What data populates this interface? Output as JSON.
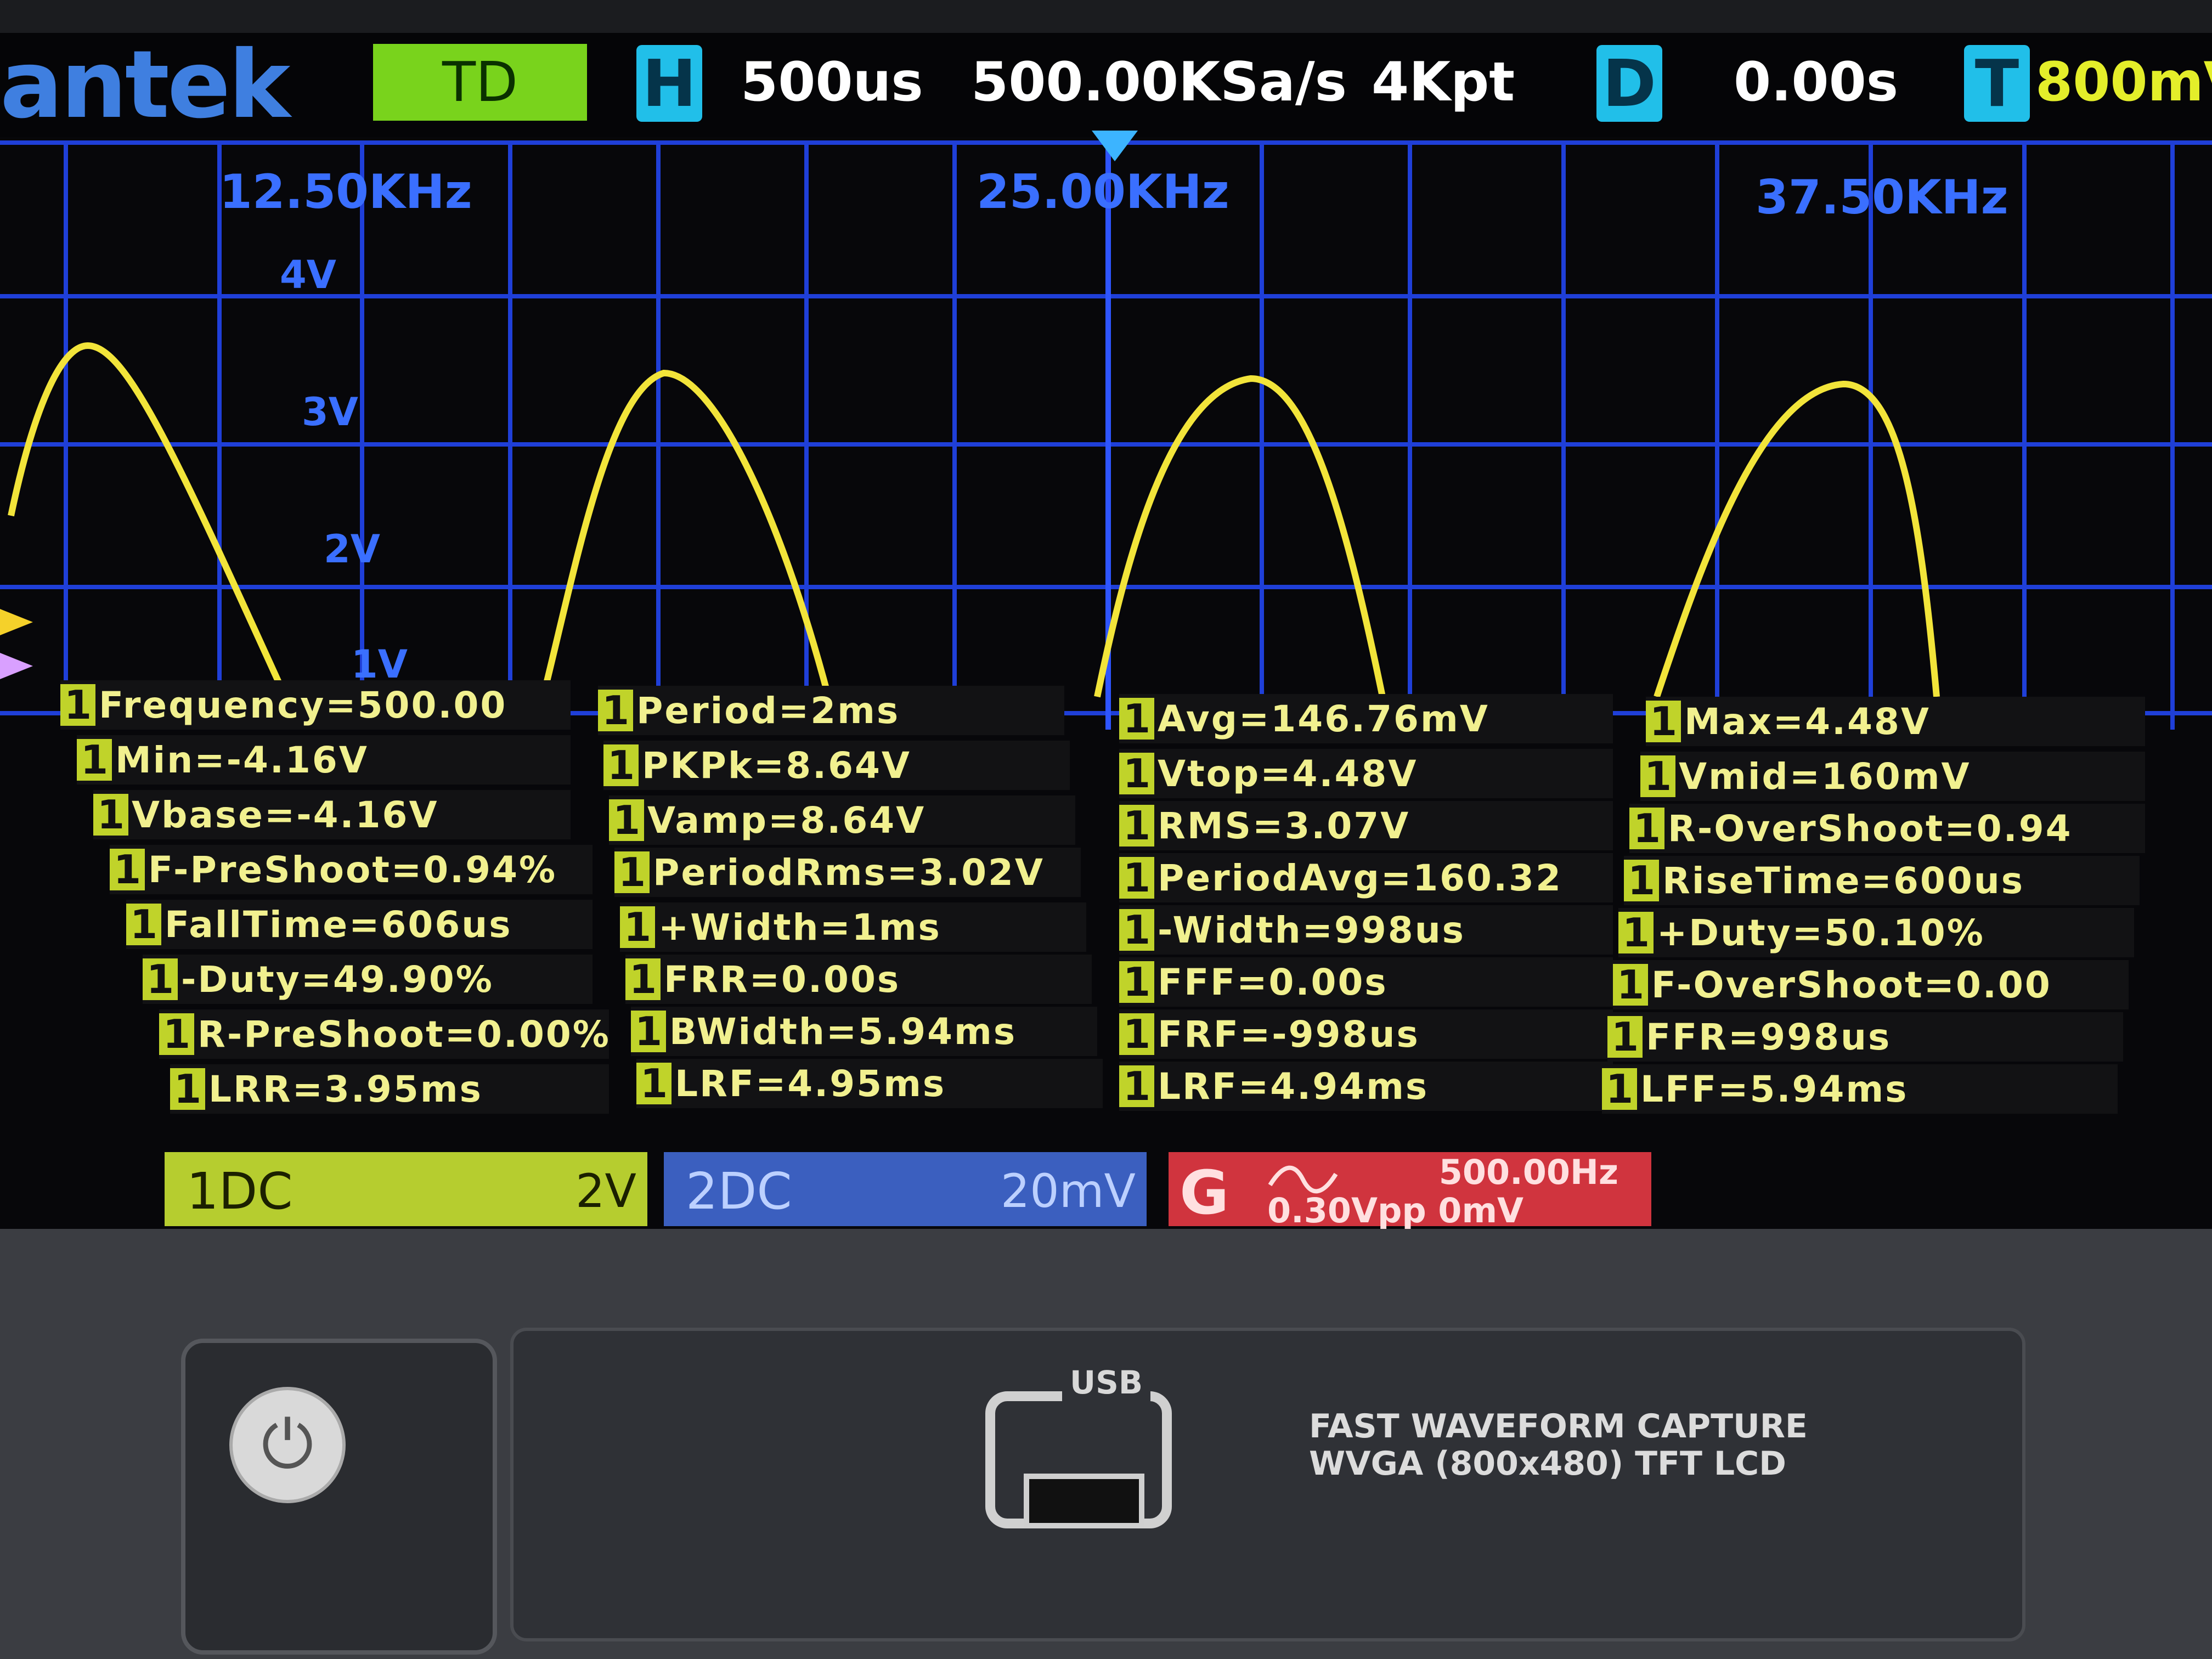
{
  "header": {
    "brand": "antek",
    "mode": "TD",
    "h_icon": "H",
    "timebase": "500us",
    "sample_rate": "500.00KSa/s",
    "memory_depth": "4Kpt",
    "d_icon": "D",
    "delay": "0.00s",
    "t_icon": "T",
    "trigger_level": "800mV"
  },
  "grid": {
    "freq_labels": [
      "12.50KHz",
      "25.00KHz",
      "37.50KHz"
    ],
    "volt_labels": [
      "4V",
      "3V",
      "2V",
      "1V"
    ]
  },
  "measurements": {
    "col1": [
      {
        "ch": "1",
        "text": "Frequency=500.00"
      },
      {
        "ch": "1",
        "text": "Min=-4.16V"
      },
      {
        "ch": "1",
        "text": "Vbase=-4.16V"
      },
      {
        "ch": "1",
        "text": "F-PreShoot=0.94%"
      },
      {
        "ch": "1",
        "text": "FallTime=606us"
      },
      {
        "ch": "1",
        "text": "-Duty=49.90%"
      },
      {
        "ch": "1",
        "text": "R-PreShoot=0.00%"
      },
      {
        "ch": "1",
        "text": "LRR=3.95ms"
      }
    ],
    "col2": [
      {
        "ch": "1",
        "text": "Period=2ms"
      },
      {
        "ch": "1",
        "text": "PKPk=8.64V"
      },
      {
        "ch": "1",
        "text": "Vamp=8.64V"
      },
      {
        "ch": "1",
        "text": "PeriodRms=3.02V"
      },
      {
        "ch": "1",
        "text": "+Width=1ms"
      },
      {
        "ch": "1",
        "text": "FRR=0.00s"
      },
      {
        "ch": "1",
        "text": "BWidth=5.94ms"
      },
      {
        "ch": "1",
        "text": "LRF=4.95ms"
      }
    ],
    "col3": [
      {
        "ch": "1",
        "text": "Avg=146.76mV"
      },
      {
        "ch": "1",
        "text": "Vtop=4.48V"
      },
      {
        "ch": "1",
        "text": "RMS=3.07V"
      },
      {
        "ch": "1",
        "text": "PeriodAvg=160.32"
      },
      {
        "ch": "1",
        "text": "-Width=998us"
      },
      {
        "ch": "1",
        "text": "FFF=0.00s"
      },
      {
        "ch": "1",
        "text": "FRF=-998us"
      },
      {
        "ch": "1",
        "text": "LRF=4.94ms"
      }
    ],
    "col4": [
      {
        "ch": "1",
        "text": "Max=4.48V"
      },
      {
        "ch": "1",
        "text": "Vmid=160mV"
      },
      {
        "ch": "1",
        "text": "R-OverShoot=0.94"
      },
      {
        "ch": "1",
        "text": "RiseTime=600us"
      },
      {
        "ch": "1",
        "text": "+Duty=50.10%"
      },
      {
        "ch": "1",
        "text": "F-OverShoot=0.00"
      },
      {
        "ch": "1",
        "text": "FFR=998us"
      },
      {
        "ch": "1",
        "text": "LFF=5.94ms"
      }
    ]
  },
  "channels": {
    "ch1": {
      "label": "1DC",
      "scale": "2V"
    },
    "ch2": {
      "label": "2DC",
      "scale": "20mV"
    },
    "gen": {
      "label": "G",
      "freq": "500.00Hz",
      "amp": "0.30Vpp 0mV"
    }
  },
  "hardware": {
    "usb_label": "USB",
    "capture_line1": "FAST WAVEFORM CAPTURE",
    "capture_line2": "WVGA (800x480) TFT LCD"
  },
  "colors": {
    "trace": "#f2e43a",
    "grid": "#1f3fd8",
    "accent": "#21bfe9"
  }
}
